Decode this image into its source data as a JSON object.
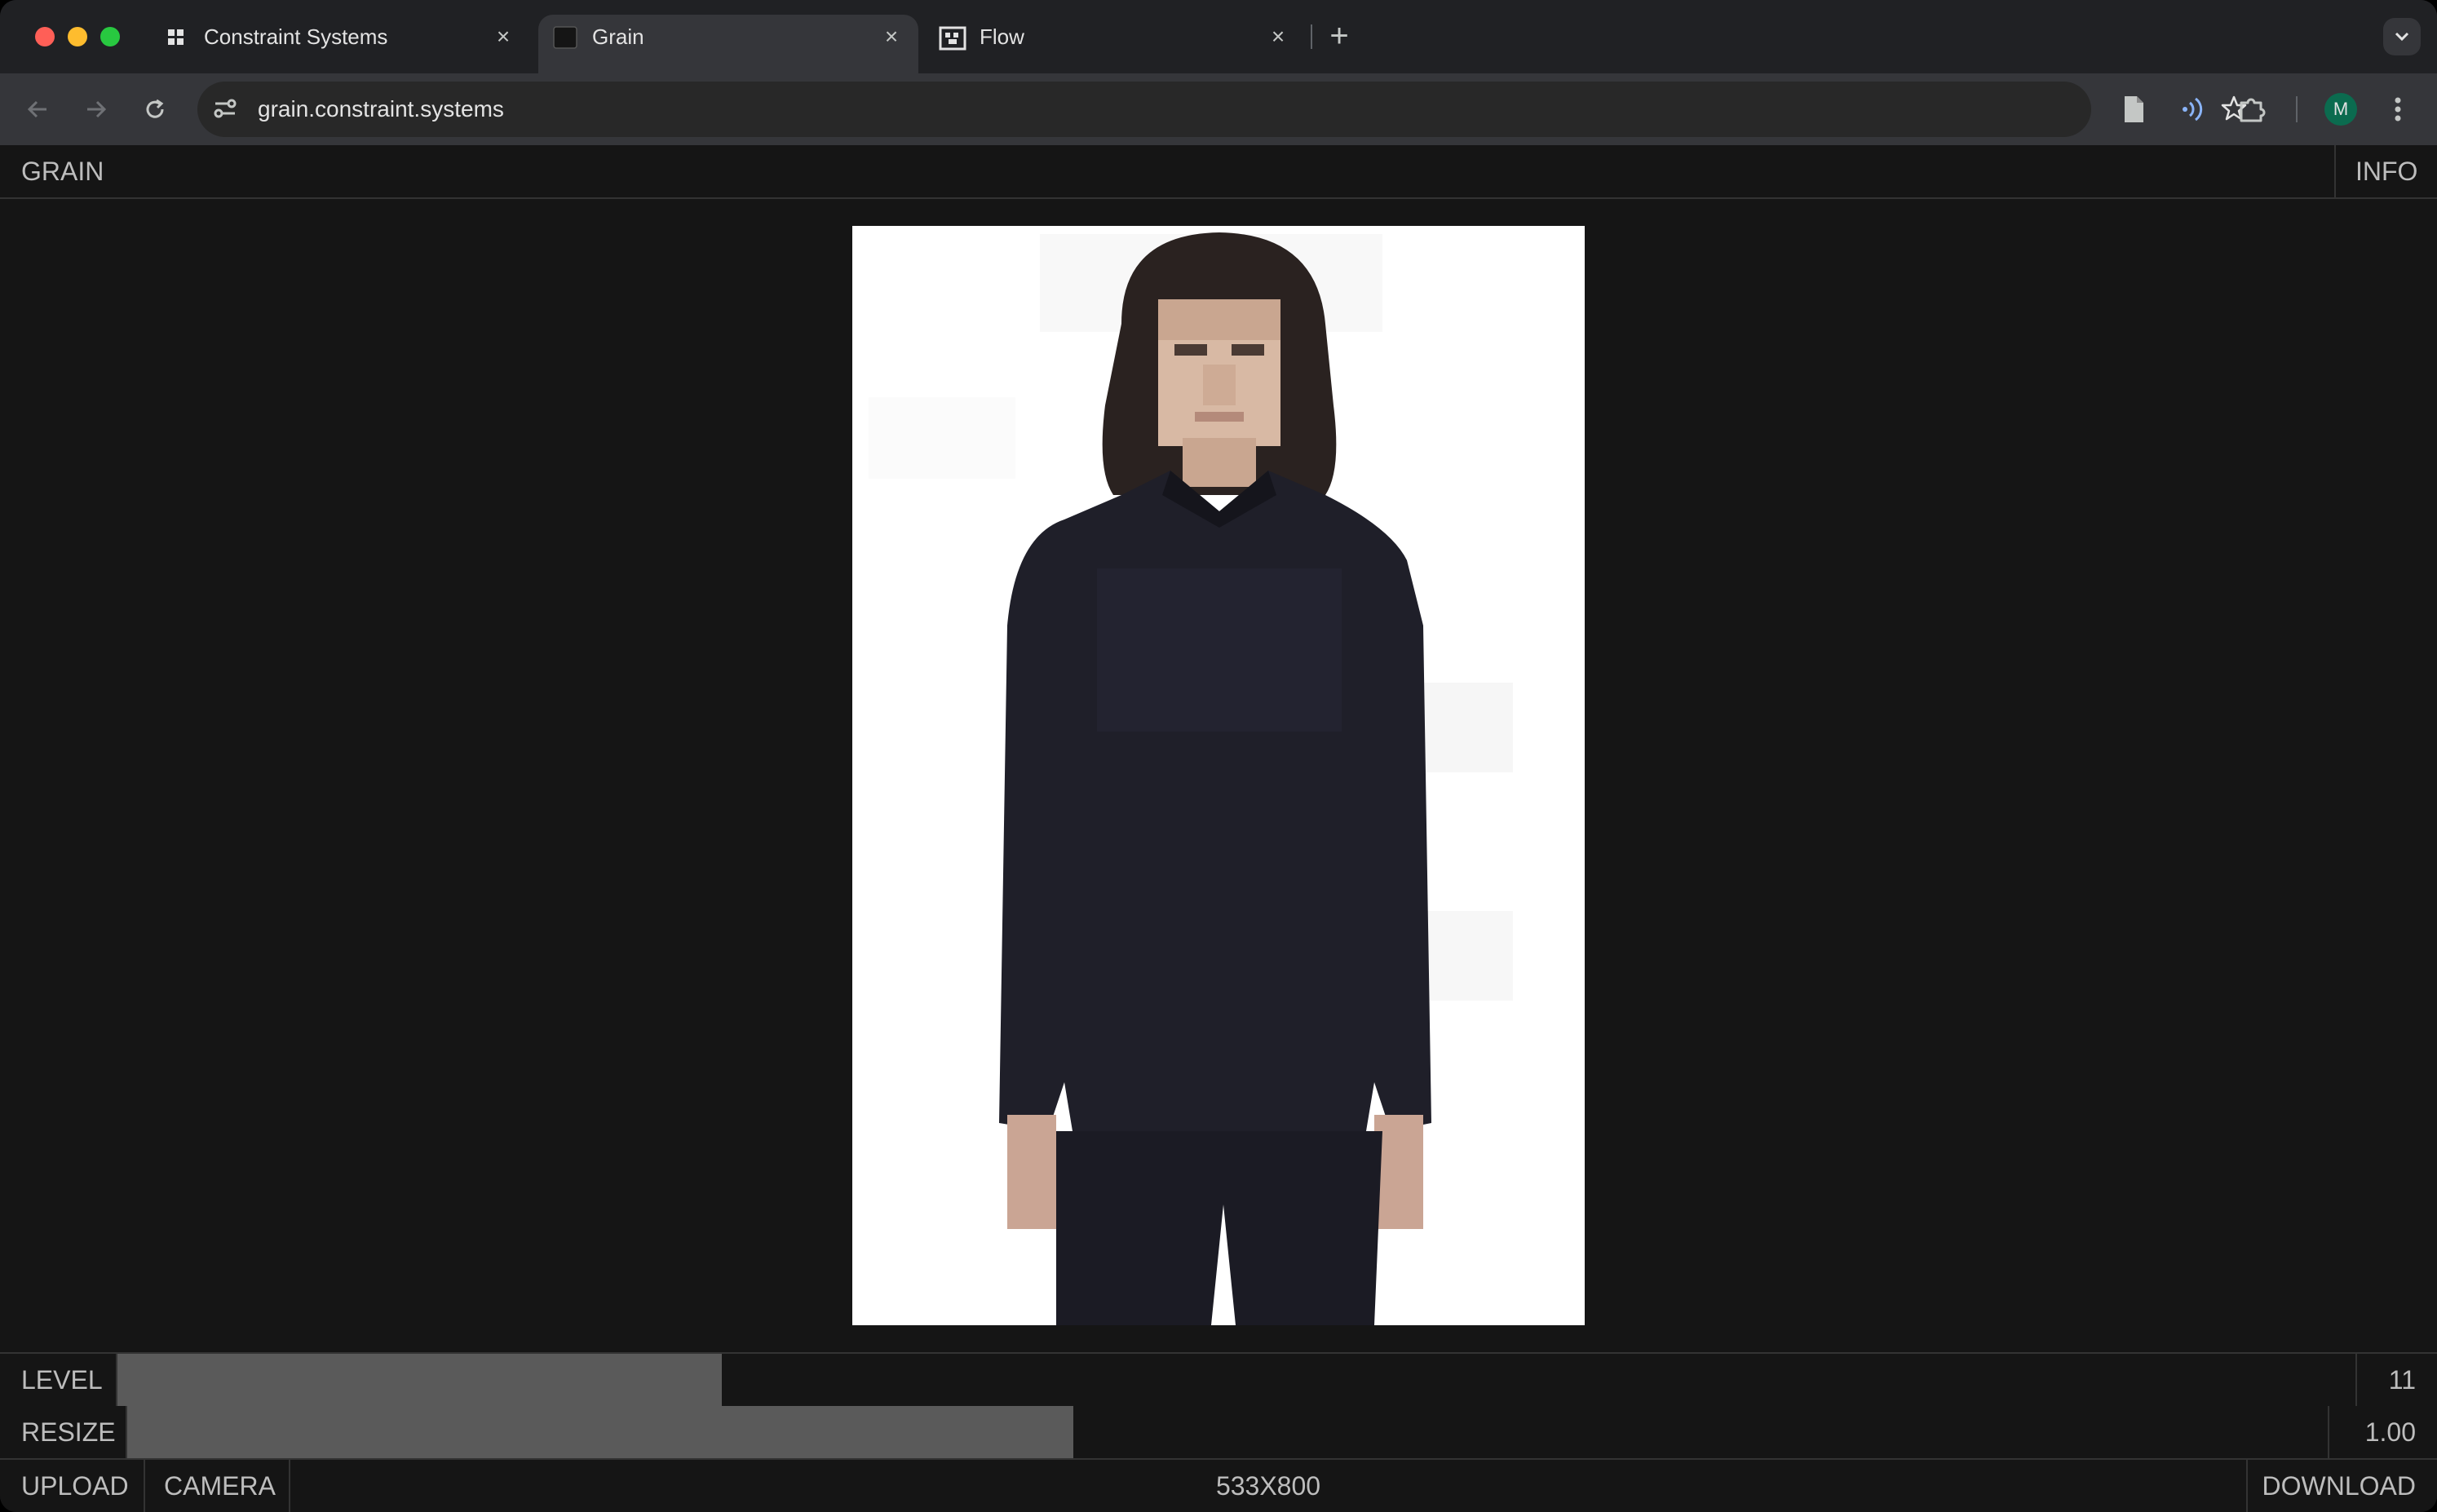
{
  "browser": {
    "tabs": [
      {
        "title": "Constraint Systems",
        "icon": "grid-icon",
        "active": false
      },
      {
        "title": "Grain",
        "icon": "dark-square-icon",
        "active": true
      },
      {
        "title": "Flow",
        "icon": "pixel-logo-icon",
        "active": false
      }
    ],
    "new_tab_label": "+",
    "close_glyph": "×",
    "url": "grain.constraint.systems",
    "profile_initial": "M",
    "colors": {
      "close_light": "#ff5f57",
      "minimize_light": "#febc2e",
      "maximize_light": "#28c840",
      "accent_blue": "#8ab4f8",
      "avatar_bg": "#0b6b4f"
    }
  },
  "app": {
    "title": "GRAIN",
    "info_label": "INFO",
    "level": {
      "label": "LEVEL",
      "value": "11",
      "fraction": 0.27
    },
    "resize": {
      "label": "RESIZE",
      "value": "1.00",
      "fraction": 0.43
    },
    "upload_label": "UPLOAD",
    "camera_label": "CAMERA",
    "dimensions": "533X800",
    "download_label": "DOWNLOAD"
  }
}
